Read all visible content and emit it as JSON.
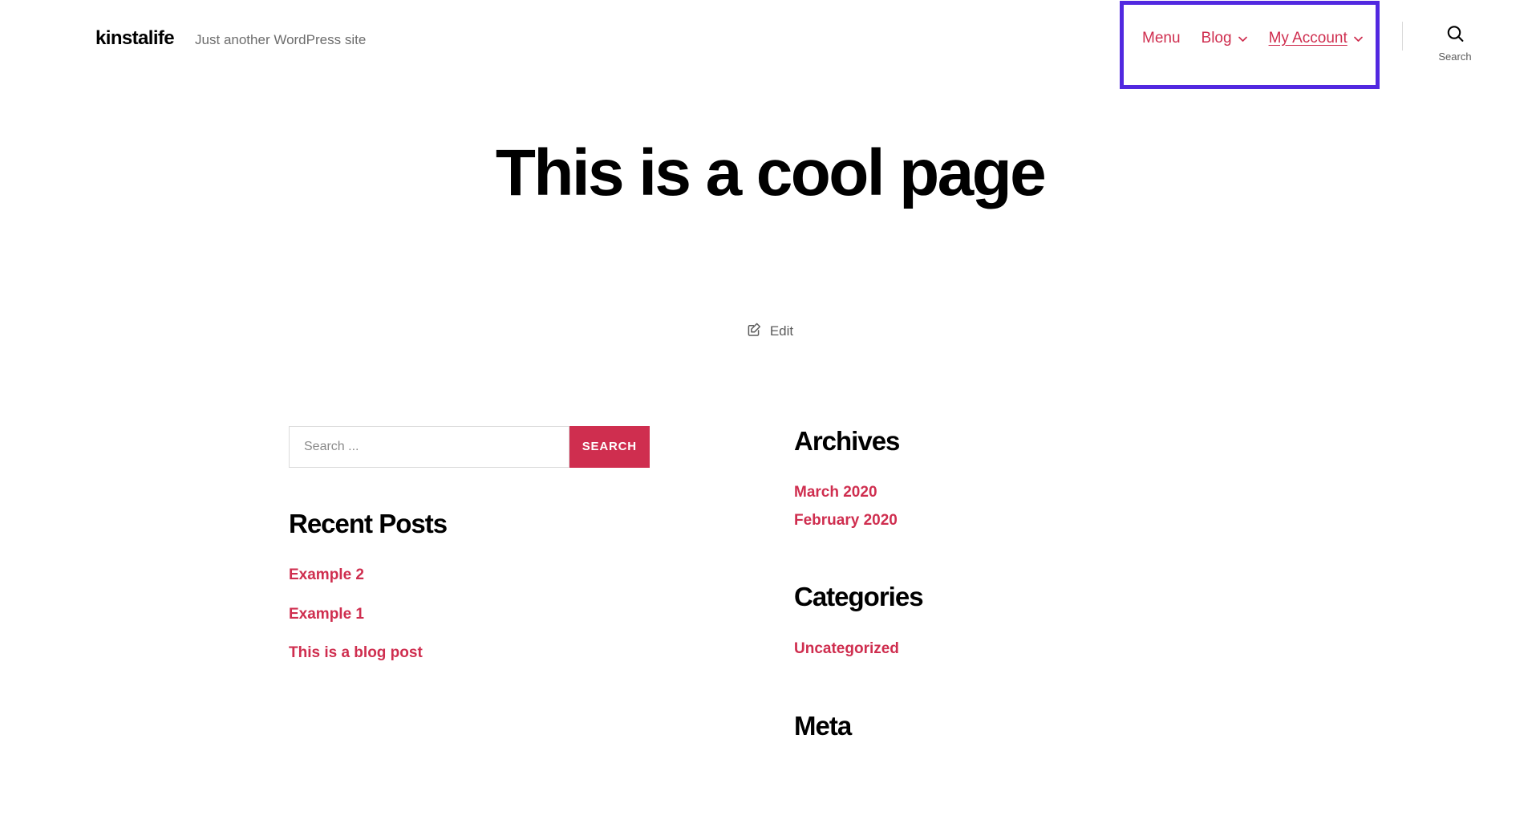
{
  "header": {
    "site_title": "kinstalife",
    "site_description": "Just another WordPress site",
    "nav": [
      {
        "label": "Menu",
        "icon": "",
        "current": false
      },
      {
        "label": "Blog",
        "icon": "chevron-down-icon",
        "current": false
      },
      {
        "label": "My Account",
        "icon": "chevron-down-icon",
        "current": true
      }
    ],
    "search_toggle": {
      "label": "Search",
      "icon": "search-icon"
    },
    "highlight_color": "#5128e0"
  },
  "main": {
    "page_title": "This is a cool page",
    "edit_link": {
      "label": "Edit",
      "icon": "edit-pencil-square-icon"
    }
  },
  "sidebar": {
    "search_widget": {
      "placeholder": "Search ...",
      "value": "",
      "submit_label": "SEARCH"
    },
    "recent_posts": {
      "title": "Recent Posts",
      "items": [
        {
          "label": "Example 2"
        },
        {
          "label": "Example 1"
        },
        {
          "label": "This is a blog post"
        }
      ]
    },
    "archives": {
      "title": "Archives",
      "items": [
        {
          "label": "March 2020"
        },
        {
          "label": "February 2020"
        }
      ]
    },
    "categories": {
      "title": "Categories",
      "items": [
        {
          "label": "Uncategorized"
        }
      ]
    },
    "meta": {
      "title": "Meta"
    }
  },
  "colors": {
    "accent": "#cf2e4f",
    "text": "#000000",
    "muted": "#6d6d6d",
    "highlight": "#5128e0",
    "border": "#dcdcdc"
  }
}
